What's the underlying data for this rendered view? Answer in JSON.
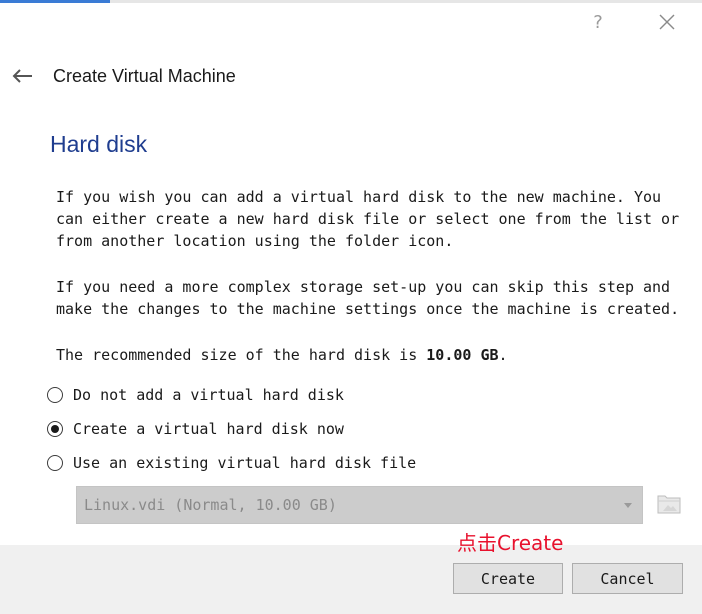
{
  "window": {
    "help_glyph": "?",
    "close_icon": "close-icon"
  },
  "wizard": {
    "back_icon": "arrow-left-icon",
    "title": "Create Virtual Machine"
  },
  "page": {
    "title": "Hard disk",
    "paragraph1": "If you wish you can add a virtual hard disk to the new machine. You can either create a new hard disk file or select one from the list or from another location using the folder icon.",
    "paragraph2": "If you need a more complex storage set-up you can skip this step and make the changes to the machine settings once the machine is created.",
    "recommend_prefix": "The recommended size of the hard disk is ",
    "recommend_size": "10.00 GB",
    "recommend_suffix": "."
  },
  "options": [
    {
      "label": "Do not add a virtual hard disk",
      "selected": false
    },
    {
      "label": "Create a virtual hard disk now",
      "selected": true
    },
    {
      "label": "Use an existing virtual hard disk file",
      "selected": false
    }
  ],
  "disk_file": {
    "value": "Linux.vdi (Normal, 10.00 GB)",
    "enabled": false,
    "folder_icon": "folder-icon"
  },
  "annotation": {
    "text": "点击Create",
    "color": "#e8112d"
  },
  "buttons": {
    "create": "Create",
    "cancel": "Cancel"
  },
  "colors": {
    "title_blue": "#1f3d8f",
    "footer_bg": "#f0f0f0",
    "combo_disabled_bg": "#cccccc"
  }
}
